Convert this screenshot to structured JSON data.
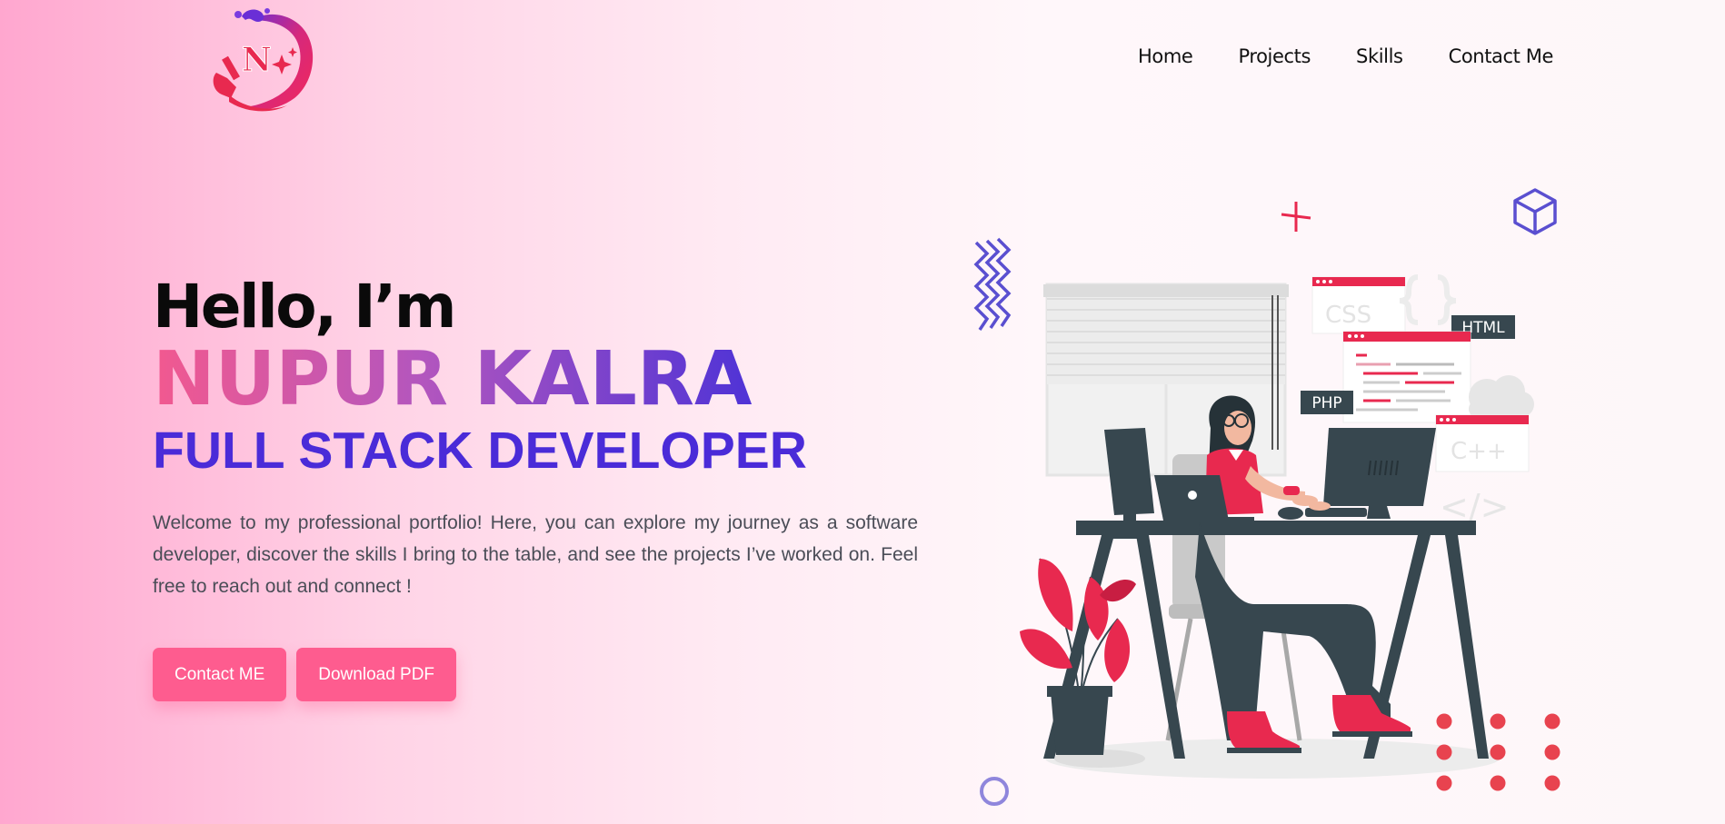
{
  "nav": {
    "items": [
      "Home",
      "Projects",
      "Skills",
      "Contact Me"
    ]
  },
  "hero": {
    "greeting": "Hello, I’m",
    "name": "NUPUR KALRA",
    "role": "FULL STACK DEVELOPER",
    "intro": "Welcome to my professional portfolio! Here, you can explore my journey as a software developer, discover the skills I bring to the table, and see the projects I’ve worked on. Feel free to reach out and connect !",
    "buttons": {
      "contact": "Contact ME",
      "download": "Download PDF"
    }
  },
  "logo": {
    "letter": "N",
    "icon": "paint-splash-logo"
  },
  "illustration": {
    "tags": {
      "css": "CSS",
      "html": "HTML",
      "php": "PHP",
      "cpp": "C++",
      "code": "</>"
    },
    "icons": [
      "zigzag-icon",
      "cross-icon",
      "cube-icon",
      "cloud-icon",
      "ring-icon",
      "dot-grid-icon",
      "braces-icon"
    ]
  },
  "colors": {
    "accent": "#fe5c8f",
    "role": "#4a2bd8",
    "name_start": "#f2598f",
    "name_end": "#4f33d6",
    "illustration_red": "#e8294f",
    "illustration_dark": "#37474f",
    "illustration_purple": "#5a4fd0"
  }
}
